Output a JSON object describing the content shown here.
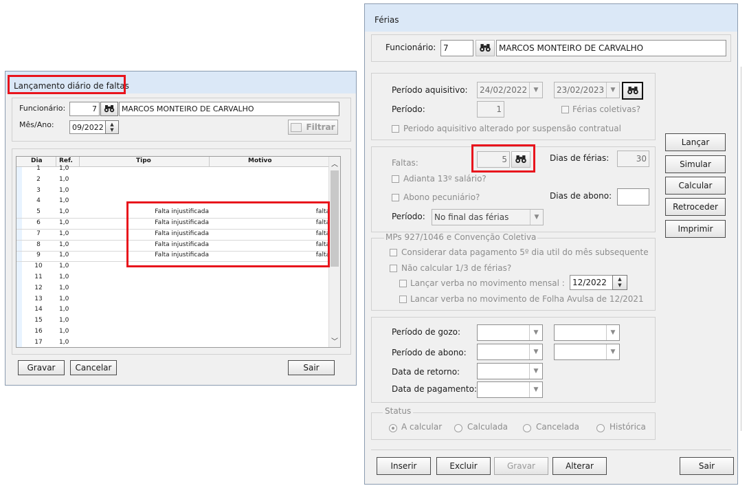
{
  "left_window": {
    "title": "Lançamento diário de faltas",
    "funcionario_label": "Funcionário:",
    "funcionario_id": "7",
    "funcionario_nome": "MARCOS MONTEIRO DE CARVALHO",
    "mes_ano_label": "Mês/Ano:",
    "mes_ano": "09/2022",
    "filtrar_label": "Filtrar",
    "columns": [
      "Dia",
      "Ref.",
      "Tipo",
      "Motivo"
    ],
    "rows": [
      {
        "dia": "1",
        "ref": "1,0",
        "tipo": "",
        "motivo": ""
      },
      {
        "dia": "2",
        "ref": "1,0",
        "tipo": "",
        "motivo": ""
      },
      {
        "dia": "3",
        "ref": "1,0",
        "tipo": "",
        "motivo": ""
      },
      {
        "dia": "4",
        "ref": "1,0",
        "tipo": "",
        "motivo": ""
      },
      {
        "dia": "5",
        "ref": "1,0",
        "tipo": "Falta injustificada",
        "motivo": "falta"
      },
      {
        "dia": "6",
        "ref": "1,0",
        "tipo": "Falta injustificada",
        "motivo": "falta"
      },
      {
        "dia": "7",
        "ref": "1,0",
        "tipo": "Falta injustificada",
        "motivo": "falta"
      },
      {
        "dia": "8",
        "ref": "1,0",
        "tipo": "Falta injustificada",
        "motivo": "falta"
      },
      {
        "dia": "9",
        "ref": "1,0",
        "tipo": "Falta injustificada",
        "motivo": "falta"
      },
      {
        "dia": "10",
        "ref": "1,0",
        "tipo": "",
        "motivo": ""
      },
      {
        "dia": "11",
        "ref": "1,0",
        "tipo": "",
        "motivo": ""
      },
      {
        "dia": "12",
        "ref": "1,0",
        "tipo": "",
        "motivo": ""
      },
      {
        "dia": "13",
        "ref": "1,0",
        "tipo": "",
        "motivo": ""
      },
      {
        "dia": "14",
        "ref": "1,0",
        "tipo": "",
        "motivo": ""
      },
      {
        "dia": "15",
        "ref": "1,0",
        "tipo": "",
        "motivo": ""
      },
      {
        "dia": "16",
        "ref": "1,0",
        "tipo": "",
        "motivo": ""
      },
      {
        "dia": "17",
        "ref": "1,0",
        "tipo": "",
        "motivo": ""
      }
    ],
    "gravar_label": "Gravar",
    "cancelar_label": "Cancelar",
    "sair_label": "Sair"
  },
  "right_window": {
    "title": "Férias",
    "funcionario_label": "Funcionário:",
    "funcionario_id": "7",
    "funcionario_nome": "MARCOS MONTEIRO DE CARVALHO",
    "periodo_aquisitivo_label": "Período aquisitivo:",
    "periodo_aquisitivo_inicio": "24/02/2022",
    "periodo_aquisitivo_fim": "23/02/2023",
    "periodo_label": "Período:",
    "periodo_value": "1",
    "ferias_coletivas_label": "Férias coletivas?",
    "periodo_alterado_label": "Periodo aquisitivo alterado por suspensão contratual",
    "faltas_label": "Faltas:",
    "faltas_value": "5",
    "dias_ferias_label": "Dias de férias:",
    "dias_ferias_value": "30",
    "adianta_13_label": "Adianta 13º salário?",
    "abono_pecuniario_label": "Abono pecuniário?",
    "dias_abono_label": "Dias de abono:",
    "dias_abono_value": "",
    "periodo_abono_label": "Período:",
    "periodo_abono_value": "No final das férias",
    "mps_group_label": "MPs 927/1046 e Convenção Coletiva",
    "considerar_data_label": "Considerar data pagamento 5º dia util do mês subsequente",
    "nao_calcular_label": "Não calcular 1/3 de férias?",
    "lancar_verba_mensal_label": "Lançar verba  no movimento mensal :",
    "lancar_verba_mensal_value": "12/2022",
    "lancar_verba_avulsa_label": "Lancar verba no movimento de Folha Avulsa de 12/2021",
    "periodo_gozo_label": "Período de gozo:",
    "periodo_abono2_label": "Período de abono:",
    "data_retorno_label": "Data de retorno:",
    "data_pagamento_label": "Data de pagamento:",
    "status_label": "Status",
    "status_options": [
      "A calcular",
      "Calculada",
      "Cancelada",
      "Histórica"
    ],
    "side_buttons": [
      "Lançar",
      "Simular",
      "Calcular",
      "Retroceder",
      "Imprimir"
    ],
    "bottom_buttons": [
      "Inserir",
      "Excluir",
      "Gravar",
      "Alterar",
      "Sair"
    ]
  },
  "colors": {
    "highlight_red": "#e8141c",
    "titlebar": "#dbe8f7",
    "window_bg": "#f0f0f0"
  }
}
